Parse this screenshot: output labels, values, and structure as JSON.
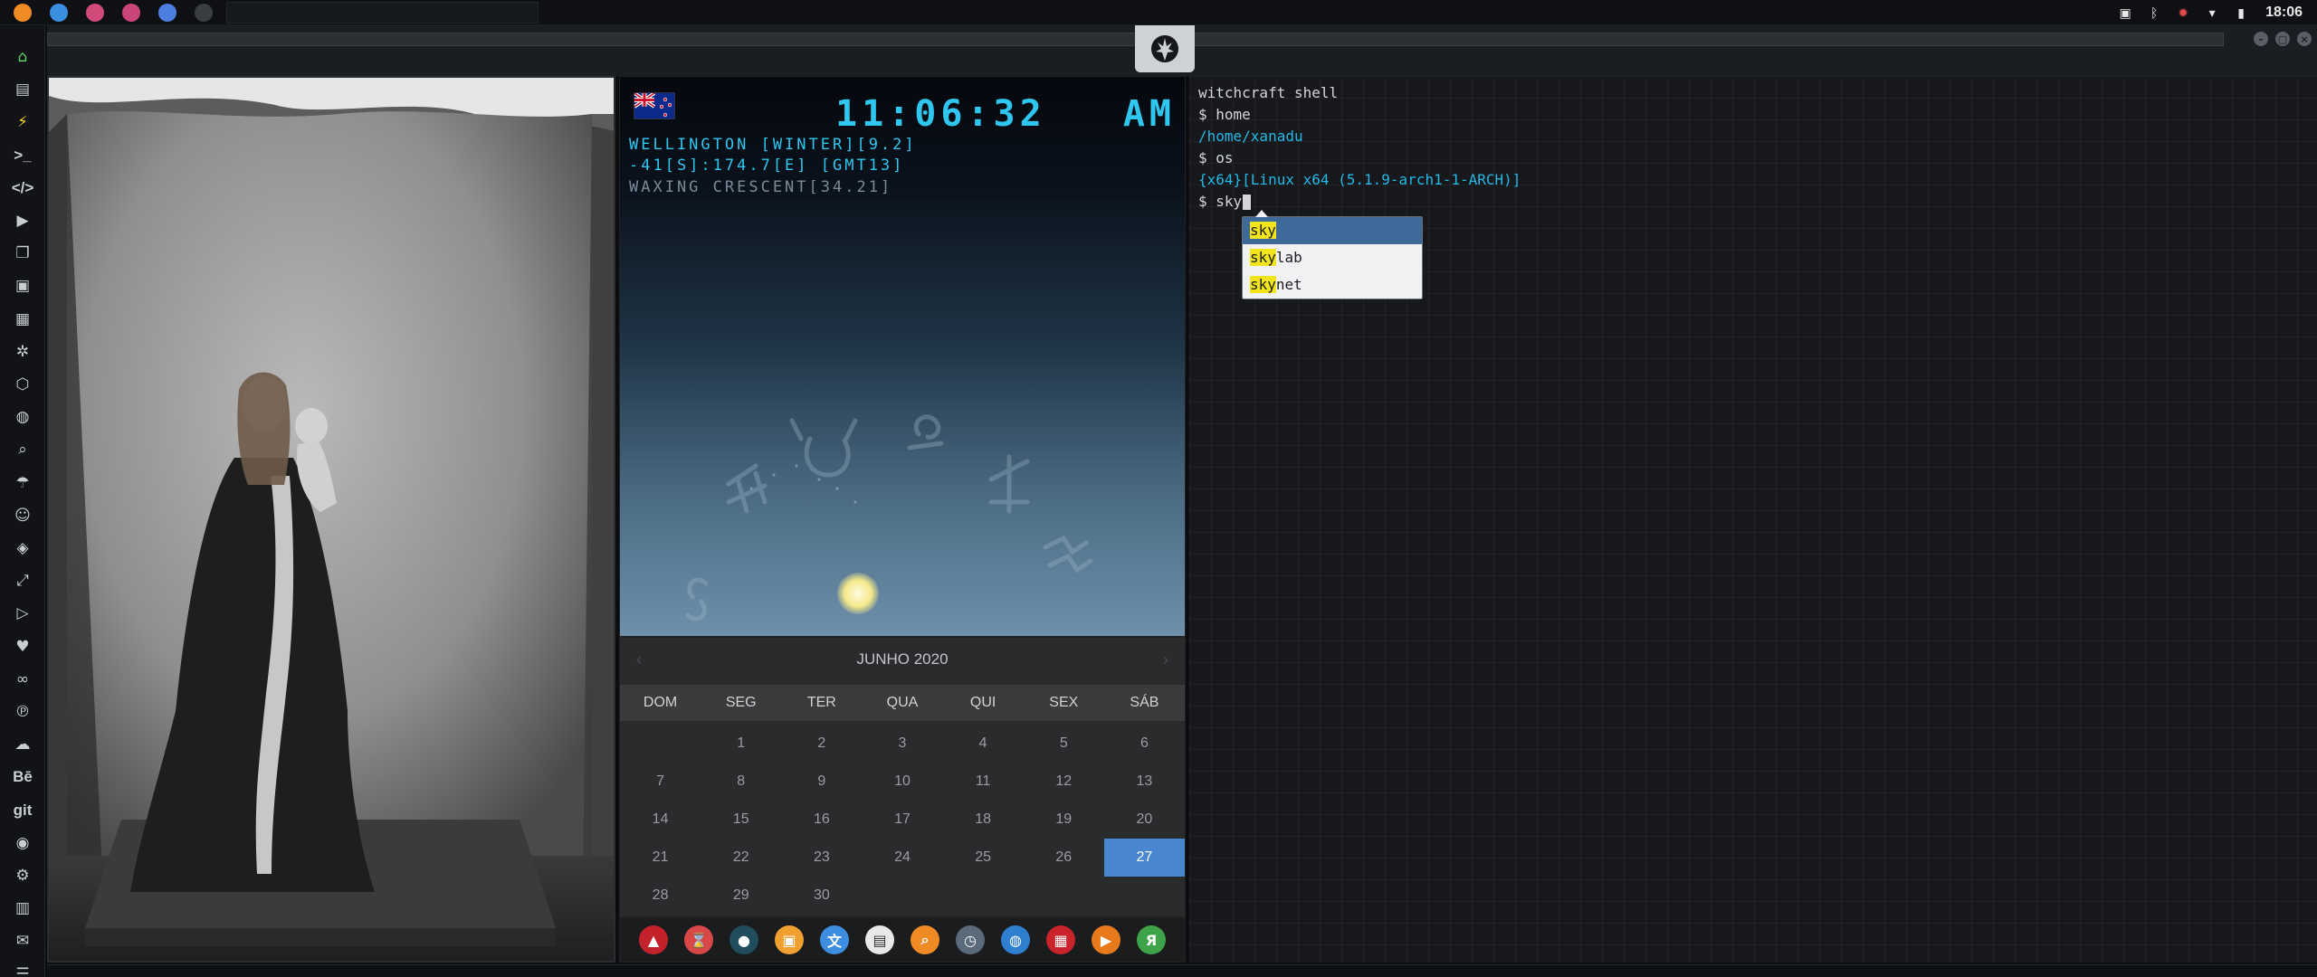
{
  "system_bar": {
    "workspaces": [
      {
        "name": "sublime",
        "color": "#f08a24"
      },
      {
        "name": "files",
        "color": "#3b8fe0"
      },
      {
        "name": "app-pink-1",
        "color": "#d04a7a"
      },
      {
        "name": "app-pink-2",
        "color": "#c9457a"
      },
      {
        "name": "chromium",
        "color": "#4d7fe0"
      },
      {
        "name": "window",
        "color": "#3a3d42"
      }
    ],
    "tray_icons": [
      "image-icon",
      "bluetooth-icon",
      "virus-icon",
      "wifi-icon",
      "battery-icon"
    ],
    "clock": "18:06"
  },
  "window": {
    "controls": [
      "minimize",
      "maximize",
      "close"
    ],
    "emblem": "rebel-alliance-icon"
  },
  "launcher": {
    "items": [
      {
        "name": "home-icon",
        "glyph": "⌂"
      },
      {
        "name": "document-icon",
        "glyph": "▤"
      },
      {
        "name": "lightning-icon",
        "glyph": "⚡"
      },
      {
        "name": "terminal-icon",
        "glyph": ">_"
      },
      {
        "name": "code-icon",
        "glyph": "</>"
      },
      {
        "name": "play-icon",
        "glyph": "▶"
      },
      {
        "name": "pages-icon",
        "glyph": "❐"
      },
      {
        "name": "image-icon",
        "glyph": "▣"
      },
      {
        "name": "news-icon",
        "glyph": "▦"
      },
      {
        "name": "aperture-icon",
        "glyph": "✲"
      },
      {
        "name": "network-icon",
        "glyph": "⬡"
      },
      {
        "name": "globe-icon",
        "glyph": "◍"
      },
      {
        "name": "search-icon",
        "glyph": "⌕"
      },
      {
        "name": "umbrella-icon",
        "glyph": "☂"
      },
      {
        "name": "contact-icon",
        "glyph": "☺"
      },
      {
        "name": "tag-icon",
        "glyph": "◈"
      },
      {
        "name": "expand-icon",
        "glyph": "⤢"
      },
      {
        "name": "youtube-icon",
        "glyph": "▷"
      },
      {
        "name": "heart-icon",
        "glyph": "♥"
      },
      {
        "name": "link-icon",
        "glyph": "∞"
      },
      {
        "name": "pinterest-icon",
        "glyph": "℗"
      },
      {
        "name": "cloud-icon",
        "glyph": "☁"
      },
      {
        "name": "behance-icon",
        "glyph": "Bē"
      },
      {
        "name": "git-icon",
        "glyph": "git"
      },
      {
        "name": "github-icon",
        "glyph": "◉"
      },
      {
        "name": "settings-icon",
        "glyph": "⚙"
      },
      {
        "name": "map-icon",
        "glyph": "▥"
      },
      {
        "name": "mail-icon",
        "glyph": "✉"
      },
      {
        "name": "server-icon",
        "glyph": "☰"
      }
    ]
  },
  "sky_widget": {
    "time": "11:06:32",
    "ampm": "AM",
    "location": "WELLINGTON [WINTER][9.2]",
    "coords": "-41[S]:174.7[E] [GMT13]",
    "moon_phase": "WAXING CRESCENT[34.21]"
  },
  "calendar": {
    "month_label": "JUNHO 2020",
    "prev": "‹",
    "next": "›",
    "weekdays": [
      "DOM",
      "SEG",
      "TER",
      "QUA",
      "QUI",
      "SEX",
      "SÁB"
    ],
    "days": [
      "",
      "1",
      "2",
      "3",
      "4",
      "5",
      "6",
      "7",
      "8",
      "9",
      "10",
      "11",
      "12",
      "13",
      "14",
      "15",
      "16",
      "17",
      "18",
      "19",
      "20",
      "21",
      "22",
      "23",
      "24",
      "25",
      "26",
      "27",
      "28",
      "29",
      "30",
      "",
      "",
      "",
      ""
    ],
    "today": "27"
  },
  "dock": {
    "items": [
      {
        "name": "app-red-icon",
        "glyph": "▲",
        "color": "#c4222b"
      },
      {
        "name": "hourglass-icon",
        "glyph": "⌛",
        "color": "#d94848"
      },
      {
        "name": "globe-dark-icon",
        "glyph": "●",
        "color": "#1f4d5c"
      },
      {
        "name": "photos-icon",
        "glyph": "▣",
        "color": "#f0a030"
      },
      {
        "name": "translate-icon",
        "glyph": "文",
        "color": "#3d8ee0"
      },
      {
        "name": "calendar-app-icon",
        "glyph": "▤",
        "color": "#e8e8e8"
      },
      {
        "name": "search-app-icon",
        "glyph": "⌕",
        "color": "#f08a24"
      },
      {
        "name": "clock-app-icon",
        "glyph": "◷",
        "color": "#5a6a7a"
      },
      {
        "name": "web-icon",
        "glyph": "◍",
        "color": "#2f7fd0"
      },
      {
        "name": "calendar-date-icon",
        "glyph": "▦",
        "color": "#c9232b"
      },
      {
        "name": "arrow-app-icon",
        "glyph": "▶",
        "color": "#e87a1c"
      },
      {
        "name": "yandex-icon",
        "glyph": "Я",
        "color": "#3fa34a"
      }
    ]
  },
  "terminal": {
    "title": "witchcraft shell",
    "lines": [
      {
        "kind": "plain",
        "text": "$ home"
      },
      {
        "kind": "path",
        "text": "/home/xanadu"
      },
      {
        "kind": "plain",
        "text": "$ os"
      },
      {
        "kind": "os",
        "text": "{x64}[Linux x64 (5.1.9-arch1-1-ARCH)]"
      }
    ],
    "prompt": "$ sky",
    "autocomplete": [
      {
        "match": "sky",
        "rest": ""
      },
      {
        "match": "sky",
        "rest": "lab"
      },
      {
        "match": "sky",
        "rest": "net"
      }
    ]
  }
}
